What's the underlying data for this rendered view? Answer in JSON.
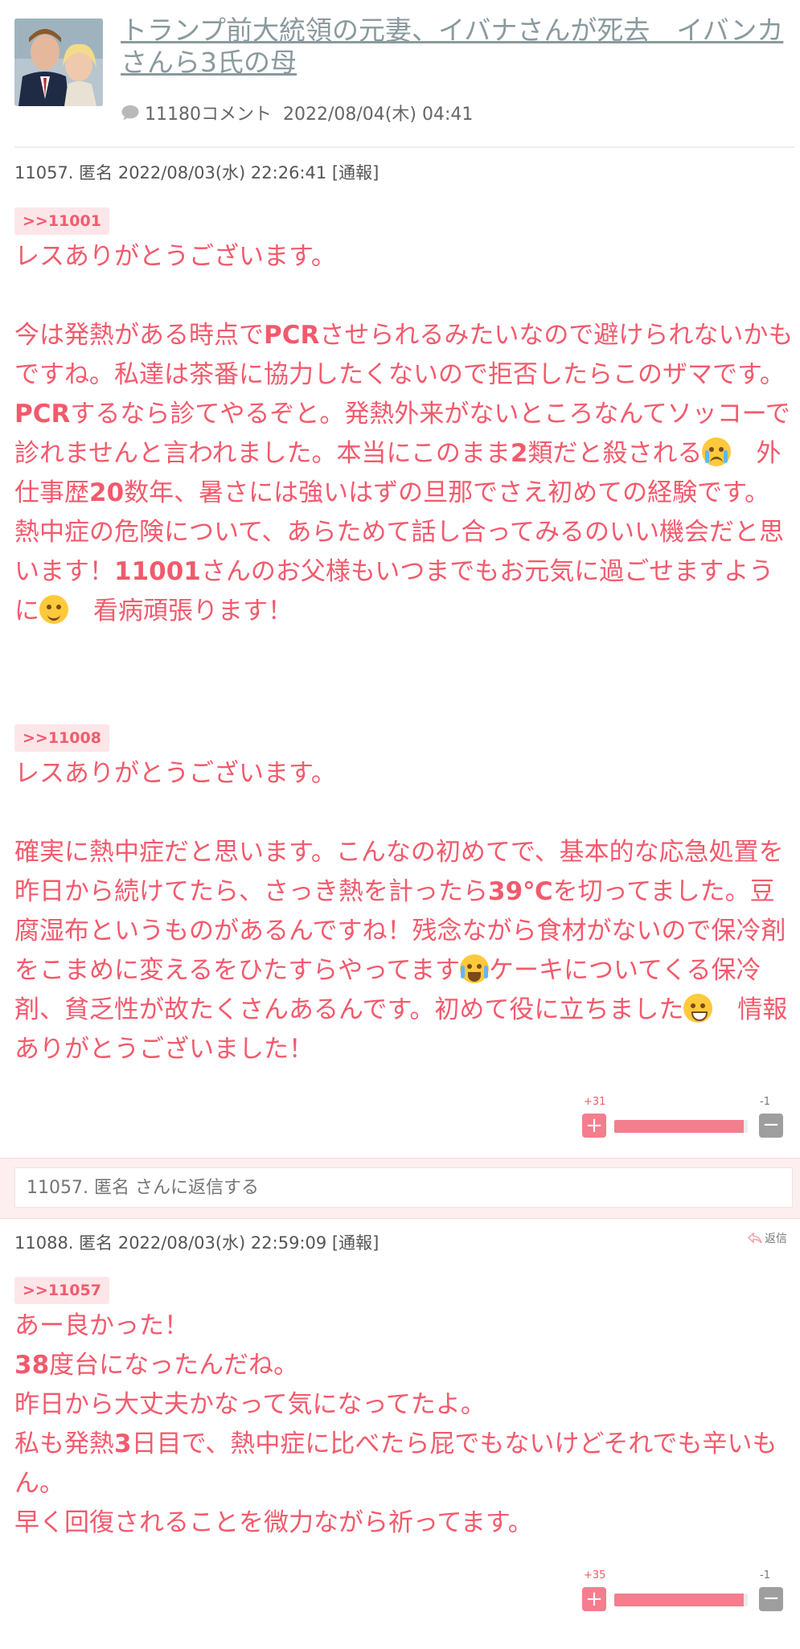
{
  "article": {
    "title": "トランプ前大統領の元妻、イバナさんが死去　イバンカさんら3氏の母",
    "comment_count": "11180コメント",
    "date": "2022/08/04(木) 04:41"
  },
  "comments": [
    {
      "header": "11057. 匿名 2022/08/03(水) 22:26:41  [通報]",
      "anchor1": ">>11001",
      "anchor2": ">>11008",
      "plus": "+31",
      "minus": "-1",
      "plus_ratio": 0.97
    },
    {
      "header": "11088. 匿名 2022/08/03(水) 22:59:09  [通報]",
      "anchor1": ">>11057",
      "plus": "+35",
      "minus": "-1",
      "plus_ratio": 0.97
    }
  ],
  "reply_placeholder": "11057. 匿名 さんに返信する",
  "reply_link": "返信",
  "colors": {
    "accent": "#f25a6c",
    "vote_plus": "#f47e8d",
    "vote_minus": "#9e9e9e"
  },
  "texts": {
    "b1_line1": "レスありがとうございます。",
    "b1_p2a": "今は発熱がある時点で",
    "b1_pcr1": "PCR",
    "b1_p2b": "させられるみたいなので避けられないかもですね。私達は茶番に協力したくないので拒否したらこのザマです。",
    "b1_pcr2": "PCR",
    "b1_p2c": "するなら診てやるぞと。発熱外来がないところなんてソッコーで診れませんと言われました。本当にこのまま",
    "b1_two": "2",
    "b1_p2d": "類だと殺される",
    "b1_p2e": "　外仕事歴",
    "b1_twenty": "20",
    "b1_p2f": "数年、暑さには強いはずの旦那でさえ初めての経験です。熱中症の危険について、あらためて話し合ってみるのいい機会だと思います！",
    "b1_num": "11001",
    "b1_p2g": "さんのお父様もいつまでもお元気に過ごせますように",
    "b1_p2h": "　看病頑張ります！",
    "b2_line1": "レスありがとうございます。",
    "b2_a": "確実に熱中症だと思います。こんなの初めてで、基本的な応急処置を昨日から続けてたら、さっき熱を計ったら",
    "b2_temp": "39℃",
    "b2_b": "を切ってました。豆腐湿布というものがあるんですね！残念ながら食材がないので保冷剤をこまめに変えるをひたすらやってます",
    "b2_c": "ケーキについてくる保冷剤、貧乏性が故たくさんあるんです。初めて役に立ちました",
    "b2_d": "　情報ありがとうございました！",
    "b3_l1": "あー良かった！",
    "b3_38": "38",
    "b3_l2": "度台になったんだね。",
    "b3_l3": "昨日から大丈夫かなって気になってたよ。",
    "b3_l4a": "私も発熱",
    "b3_3": "3",
    "b3_l4b": "日目で、熱中症に比べたら屁でもないけどそれでも辛いもん。",
    "b3_l5": "早く回復されることを微力ながら祈ってます。"
  }
}
